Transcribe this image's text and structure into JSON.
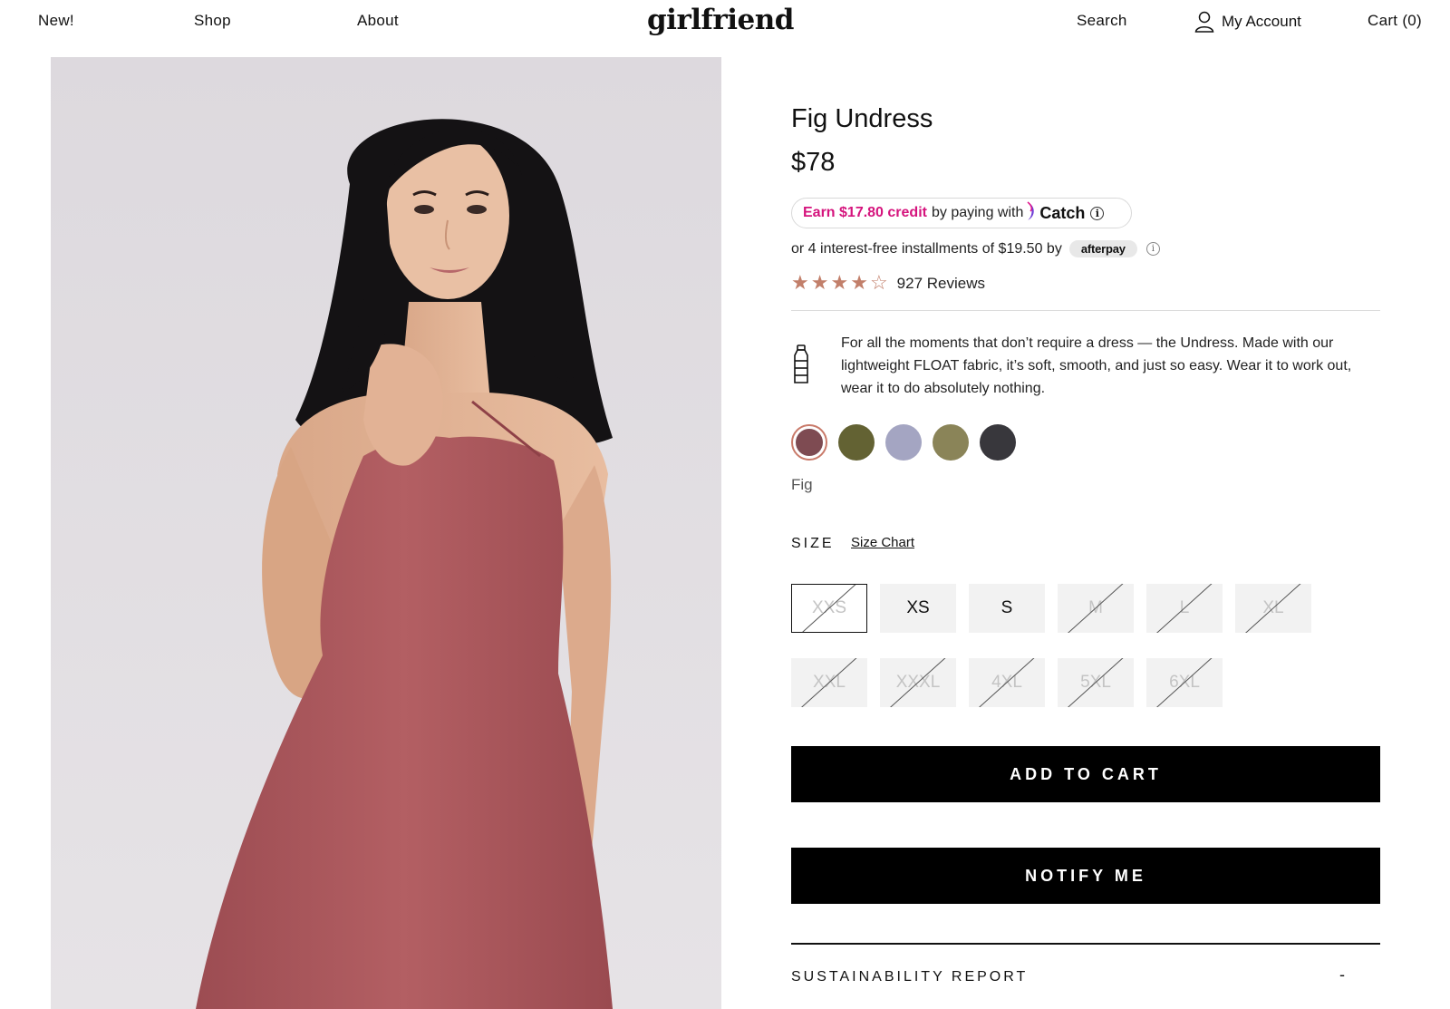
{
  "header": {
    "nav": [
      {
        "label": "New!"
      },
      {
        "label": "Shop"
      },
      {
        "label": "About"
      }
    ],
    "logo": "girlfriend",
    "search_label": "Search",
    "account_label": "My Account",
    "cart_label": "Cart (0)"
  },
  "product": {
    "title": "Fig Undress",
    "price": "$78",
    "catch": {
      "earn": "Earn $17.80 credit",
      "by": "by paying with",
      "brand": "Catch",
      "info": "i"
    },
    "afterpay": {
      "text": "or 4 interest-free installments of $19.50 by",
      "badge": "afterpay",
      "info": "i"
    },
    "rating": {
      "value": 4,
      "max": 5,
      "reviews_label": "927 Reviews"
    },
    "description": "For all the moments that don’t require a dress — the Undress. Made with our lightweight FLOAT fabric, it’s soft, smooth, and just so easy. Wear it to work out, wear it to do absolutely nothing.",
    "swatches": [
      {
        "color": "#7e4b52",
        "selected": true
      },
      {
        "color": "#636233",
        "selected": false
      },
      {
        "color": "#a4a5c2",
        "selected": false
      },
      {
        "color": "#8a8458",
        "selected": false
      },
      {
        "color": "#38373c",
        "selected": false
      }
    ],
    "selected_color": "Fig",
    "size_label": "SIZE",
    "size_chart_label": "Size Chart",
    "sizes": [
      {
        "label": "XXS",
        "available": false,
        "boxed": true
      },
      {
        "label": "XS",
        "available": true,
        "boxed": false
      },
      {
        "label": "S",
        "available": true,
        "boxed": false
      },
      {
        "label": "M",
        "available": false,
        "boxed": false
      },
      {
        "label": "L",
        "available": false,
        "boxed": false
      },
      {
        "label": "XL",
        "available": false,
        "boxed": false
      },
      {
        "label": "XXL",
        "available": false,
        "boxed": false
      },
      {
        "label": "XXXL",
        "available": false,
        "boxed": false
      },
      {
        "label": "4XL",
        "available": false,
        "boxed": false
      },
      {
        "label": "5XL",
        "available": false,
        "boxed": false
      },
      {
        "label": "6XL",
        "available": false,
        "boxed": false
      }
    ],
    "add_to_cart_label": "ADD TO CART",
    "notify_label": "NOTIFY ME",
    "accordion": {
      "title": "SUSTAINABILITY REPORT",
      "toggle": "-"
    }
  },
  "colors": {
    "star": "#c27f6a",
    "catch_pink": "#d5147d",
    "dress": "#a9545a",
    "backdrop": "#e3dfe3"
  },
  "icons": [
    "user-icon",
    "catch-moon-icon",
    "info-icon",
    "star-icon",
    "water-bottle-icon"
  ]
}
